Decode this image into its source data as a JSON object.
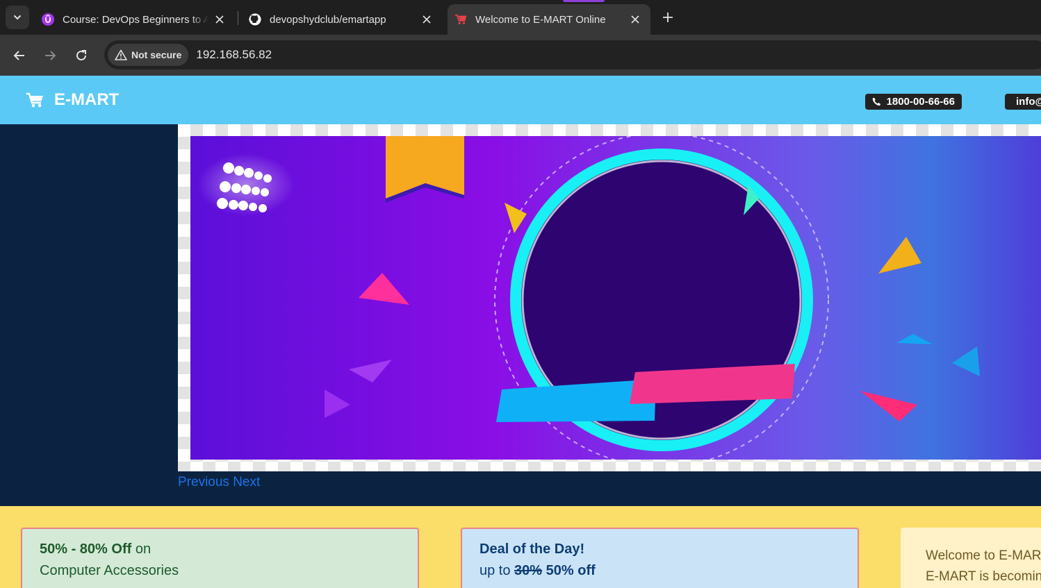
{
  "browser": {
    "tabs": [
      {
        "title": "Course: DevOps Beginners to Ad",
        "favicon": "udemy-icon",
        "active": false
      },
      {
        "title": "devopshydclub/emartapp",
        "favicon": "github-icon",
        "active": false
      },
      {
        "title": "Welcome to E-MART Online",
        "favicon": "cart-icon",
        "active": true
      }
    ],
    "security_label": "Not secure",
    "url": "192.168.56.82"
  },
  "site": {
    "brand": "E-MART",
    "phone": "1800-00-66-66",
    "email": "info@"
  },
  "carousel": {
    "previous_label": "Previous",
    "next_label": "Next"
  },
  "promo": {
    "card1": {
      "highlight": "50% - 80% Off",
      "rest": " on",
      "line2": "Computer Accessories"
    },
    "card2": {
      "line1": "Deal of the Day!",
      "prefix": "up to ",
      "old_discount": "30%",
      "new_discount": " 50% off"
    },
    "card3": {
      "line1": "Welcome to E-MAR",
      "line2": "E-MART is becomin"
    }
  },
  "colors": {
    "header": "#5bc9f5",
    "page_background": "#0b2340",
    "promo_band": "#fbdd6a",
    "link": "#1a73e8"
  }
}
